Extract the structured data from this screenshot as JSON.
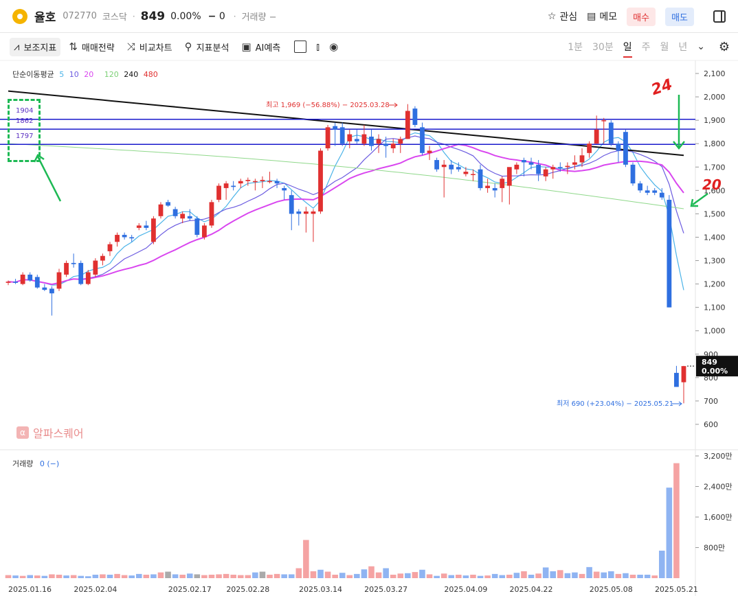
{
  "header": {
    "name": "율호",
    "code": "072770",
    "market": "코스닥",
    "price": "849",
    "change_pct": "0.00%",
    "change_sign": "−",
    "change_val": "0",
    "volume": "거래량 −",
    "favorite": "관심",
    "memo": "메모",
    "buy": "매수",
    "sell": "매도"
  },
  "toolbar": {
    "indicators": "보조지표",
    "strategy": "매매전략",
    "compare": "비교차트",
    "analysis": "지표분석",
    "ai": "AI예측",
    "periods": [
      "1분",
      "30분",
      "일",
      "주",
      "월",
      "년"
    ],
    "selected_period": "일"
  },
  "legend": {
    "title": "단순이동평균",
    "ma": [
      {
        "label": "5",
        "color": "#4ab3e8"
      },
      {
        "label": "10",
        "color": "#6b5be0"
      },
      {
        "label": "20",
        "color": "#d946ef"
      },
      {
        "label": "120",
        "color": "#8fd88a"
      },
      {
        "label": "240",
        "color": "#111111"
      },
      {
        "label": "480",
        "color": "#e03030"
      }
    ]
  },
  "volume_legend": {
    "label": "거래량",
    "value": "0 (−)"
  },
  "watermark": "알파스퀘어",
  "level_box": [
    "1904",
    "1862",
    "1797"
  ],
  "annotations": {
    "high": "최고 1,969 (−56.88%) − 2025.03.28",
    "low": "최저 690 (+23.04%) − 2025.05.21",
    "label_24": "24",
    "label_20": "20",
    "price_tag": "849",
    "price_tag_pct": "0.00%"
  },
  "colors": {
    "up": "#e03030",
    "down": "#2f6fe0",
    "level_line": "#1a1acc"
  },
  "chart_data": {
    "type": "candlestick",
    "y_ticks": [
      "2,100",
      "2,000",
      "1,900",
      "1,800",
      "1,700",
      "1,600",
      "1,500",
      "1,400",
      "1,300",
      "1,200",
      "1,100",
      "1,000",
      "900",
      "800",
      "700",
      "600"
    ],
    "ylim": [
      560,
      2130
    ],
    "vol_ticks": [
      "3,200만",
      "2,400만",
      "1,600만",
      "800만"
    ],
    "vol_ylim": [
      0,
      3300
    ],
    "x_ticks": [
      "2025.01.16",
      "2025.02.04",
      "2025.02.17",
      "2025.02.28",
      "2025.03.14",
      "2025.03.27",
      "2025.04.09",
      "2025.04.22",
      "2025.05.08",
      "2025.05.21"
    ],
    "level_lines": [
      1904,
      1862,
      1797
    ],
    "candles": [
      [
        1205,
        1215,
        1195,
        1210
      ],
      [
        1210,
        1222,
        1200,
        1205
      ],
      [
        1200,
        1250,
        1195,
        1240
      ],
      [
        1240,
        1250,
        1210,
        1215
      ],
      [
        1230,
        1240,
        1180,
        1185
      ],
      [
        1185,
        1200,
        1170,
        1175
      ],
      [
        1180,
        1190,
        1065,
        1160
      ],
      [
        1180,
        1265,
        1170,
        1250
      ],
      [
        1240,
        1300,
        1230,
        1290
      ],
      [
        1290,
        1330,
        1270,
        1285
      ],
      [
        1290,
        1300,
        1195,
        1200
      ],
      [
        1200,
        1260,
        1195,
        1250
      ],
      [
        1240,
        1310,
        1230,
        1300
      ],
      [
        1300,
        1330,
        1280,
        1320
      ],
      [
        1340,
        1380,
        1320,
        1370
      ],
      [
        1380,
        1420,
        1360,
        1410
      ],
      [
        1410,
        1420,
        1390,
        1400
      ],
      [
        1400,
        1410,
        1380,
        1395
      ],
      [
        1440,
        1460,
        1430,
        1450
      ],
      [
        1450,
        1470,
        1430,
        1440
      ],
      [
        1380,
        1490,
        1370,
        1480
      ],
      [
        1490,
        1550,
        1480,
        1540
      ],
      [
        1550,
        1560,
        1530,
        1535
      ],
      [
        1520,
        1530,
        1480,
        1490
      ],
      [
        1480,
        1510,
        1460,
        1500
      ],
      [
        1490,
        1520,
        1470,
        1480
      ],
      [
        1480,
        1490,
        1400,
        1410
      ],
      [
        1400,
        1460,
        1390,
        1450
      ],
      [
        1450,
        1560,
        1440,
        1550
      ],
      [
        1560,
        1630,
        1550,
        1620
      ],
      [
        1610,
        1640,
        1560,
        1630
      ],
      [
        1620,
        1640,
        1600,
        1615
      ],
      [
        1630,
        1650,
        1610,
        1640
      ],
      [
        1640,
        1655,
        1620,
        1645
      ],
      [
        1640,
        1650,
        1600,
        1640
      ],
      [
        1640,
        1660,
        1610,
        1645
      ],
      [
        1640,
        1680,
        1630,
        1640
      ],
      [
        1640,
        1650,
        1610,
        1630
      ],
      [
        1610,
        1620,
        1560,
        1600
      ],
      [
        1580,
        1600,
        1430,
        1500
      ],
      [
        1510,
        1520,
        1450,
        1500
      ],
      [
        1500,
        1530,
        1420,
        1510
      ],
      [
        1500,
        1520,
        1380,
        1510
      ],
      [
        1510,
        1780,
        1500,
        1770
      ],
      [
        1780,
        1880,
        1770,
        1870
      ],
      [
        1875,
        1890,
        1790,
        1860
      ],
      [
        1870,
        1890,
        1790,
        1800
      ],
      [
        1810,
        1860,
        1780,
        1840
      ],
      [
        1820,
        1860,
        1800,
        1810
      ],
      [
        1800,
        1880,
        1790,
        1840
      ],
      [
        1830,
        1860,
        1770,
        1790
      ],
      [
        1800,
        1840,
        1760,
        1820
      ],
      [
        1800,
        1830,
        1740,
        1790
      ],
      [
        1780,
        1820,
        1760,
        1800
      ],
      [
        1800,
        1830,
        1760,
        1820
      ],
      [
        1820,
        1969,
        1820,
        1940
      ],
      [
        1950,
        1960,
        1870,
        1880
      ],
      [
        1870,
        1890,
        1750,
        1760
      ],
      [
        1760,
        1790,
        1730,
        1770
      ],
      [
        1730,
        1740,
        1680,
        1690
      ],
      [
        1700,
        1730,
        1570,
        1710
      ],
      [
        1710,
        1730,
        1670,
        1690
      ],
      [
        1700,
        1720,
        1680,
        1690
      ],
      [
        1670,
        1700,
        1660,
        1680
      ],
      [
        1670,
        1690,
        1640,
        1670
      ],
      [
        1690,
        1710,
        1600,
        1610
      ],
      [
        1610,
        1650,
        1590,
        1620
      ],
      [
        1610,
        1630,
        1570,
        1600
      ],
      [
        1610,
        1660,
        1550,
        1650
      ],
      [
        1620,
        1680,
        1540,
        1700
      ],
      [
        1690,
        1720,
        1670,
        1710
      ],
      [
        1730,
        1740,
        1660,
        1720
      ],
      [
        1720,
        1740,
        1690,
        1710
      ],
      [
        1710,
        1730,
        1640,
        1670
      ],
      [
        1660,
        1700,
        1640,
        1690
      ],
      [
        1690,
        1710,
        1650,
        1700
      ],
      [
        1700,
        1720,
        1680,
        1695
      ],
      [
        1700,
        1720,
        1670,
        1705
      ],
      [
        1710,
        1750,
        1690,
        1720
      ],
      [
        1720,
        1780,
        1700,
        1750
      ],
      [
        1760,
        1810,
        1740,
        1800
      ],
      [
        1800,
        1920,
        1800,
        1860
      ],
      [
        1900,
        1910,
        1800,
        1900
      ],
      [
        1890,
        1900,
        1790,
        1800
      ],
      [
        1800,
        1810,
        1720,
        1770
      ],
      [
        1850,
        1860,
        1700,
        1710
      ],
      [
        1710,
        1720,
        1620,
        1630
      ],
      [
        1630,
        1640,
        1590,
        1600
      ],
      [
        1600,
        1620,
        1580,
        1590
      ],
      [
        1600,
        1610,
        1580,
        1590
      ],
      [
        1590,
        1610,
        1560,
        1570
      ],
      [
        1560,
        1580,
        1100,
        1100
      ],
      [
        820,
        850,
        760,
        760
      ],
      [
        780,
        850,
        690,
        849
      ]
    ],
    "volumes": [
      [
        80,
        0
      ],
      [
        70,
        1
      ],
      [
        60,
        0
      ],
      [
        80,
        1
      ],
      [
        70,
        0
      ],
      [
        60,
        1
      ],
      [
        100,
        0
      ],
      [
        90,
        0
      ],
      [
        70,
        1
      ],
      [
        80,
        0
      ],
      [
        60,
        1
      ],
      [
        50,
        1
      ],
      [
        90,
        1
      ],
      [
        100,
        0
      ],
      [
        90,
        1
      ],
      [
        110,
        0
      ],
      [
        80,
        0
      ],
      [
        70,
        1
      ],
      [
        110,
        1
      ],
      [
        90,
        0
      ],
      [
        100,
        1
      ],
      [
        150,
        0
      ],
      [
        170,
        2
      ],
      [
        100,
        1
      ],
      [
        90,
        0
      ],
      [
        120,
        1
      ],
      [
        100,
        2
      ],
      [
        80,
        0
      ],
      [
        90,
        0
      ],
      [
        100,
        0
      ],
      [
        110,
        0
      ],
      [
        90,
        0
      ],
      [
        80,
        0
      ],
      [
        80,
        0
      ],
      [
        150,
        1
      ],
      [
        170,
        2
      ],
      [
        90,
        0
      ],
      [
        110,
        0
      ],
      [
        100,
        1
      ],
      [
        100,
        1
      ],
      [
        260,
        0
      ],
      [
        1000,
        0
      ],
      [
        180,
        0
      ],
      [
        220,
        1
      ],
      [
        170,
        0
      ],
      [
        90,
        0
      ],
      [
        140,
        1
      ],
      [
        80,
        0
      ],
      [
        110,
        1
      ],
      [
        230,
        1
      ],
      [
        310,
        0
      ],
      [
        150,
        0
      ],
      [
        260,
        1
      ],
      [
        90,
        0
      ],
      [
        120,
        0
      ],
      [
        130,
        1
      ],
      [
        160,
        0
      ],
      [
        220,
        1
      ],
      [
        100,
        0
      ],
      [
        60,
        1
      ],
      [
        120,
        0
      ],
      [
        80,
        1
      ],
      [
        90,
        0
      ],
      [
        70,
        1
      ],
      [
        90,
        0
      ],
      [
        60,
        1
      ],
      [
        70,
        0
      ],
      [
        110,
        1
      ],
      [
        80,
        1
      ],
      [
        90,
        0
      ],
      [
        140,
        1
      ],
      [
        180,
        0
      ],
      [
        90,
        1
      ],
      [
        120,
        0
      ],
      [
        280,
        1
      ],
      [
        180,
        1
      ],
      [
        210,
        0
      ],
      [
        130,
        1
      ],
      [
        150,
        1
      ],
      [
        110,
        0
      ],
      [
        290,
        1
      ],
      [
        170,
        0
      ],
      [
        150,
        1
      ],
      [
        180,
        1
      ],
      [
        110,
        0
      ],
      [
        130,
        1
      ],
      [
        90,
        0
      ],
      [
        90,
        1
      ],
      [
        90,
        1
      ],
      [
        70,
        0
      ],
      [
        720,
        1
      ],
      [
        2370,
        1
      ],
      [
        3010,
        0
      ]
    ]
  }
}
